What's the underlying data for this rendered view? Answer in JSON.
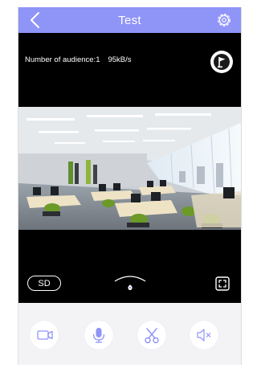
{
  "navbar": {
    "title": "Test",
    "back_icon": "chevron-left-icon",
    "settings_icon": "gear-icon",
    "color": "#8f94f7"
  },
  "video": {
    "audience_label": "Number of audience:1",
    "bitrate": "95kB/s",
    "snapshot_icon": "flag-icon",
    "quality_label": "SD",
    "fullscreen_icon": "fullscreen-icon",
    "ptz_icon": "direction-indicator-icon"
  },
  "controls": {
    "items": [
      {
        "name": "record",
        "icon": "video-camera-icon"
      },
      {
        "name": "talk",
        "icon": "microphone-icon"
      },
      {
        "name": "snapshot",
        "icon": "scissors-icon"
      },
      {
        "name": "mute",
        "icon": "speaker-muted-icon"
      }
    ],
    "accent": "#8f94f7",
    "background": "#f3f3f6"
  }
}
